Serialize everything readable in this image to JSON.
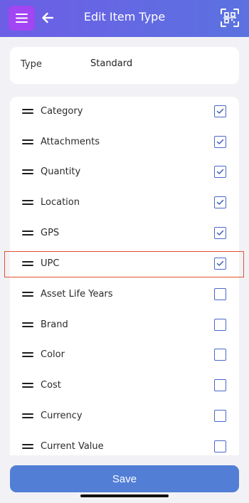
{
  "header": {
    "title": "Edit Item Type",
    "menu_icon": "hamburger-menu-icon",
    "back_icon": "arrow-left-icon",
    "scan_icon": "qr-scan-icon",
    "accent": "#6d5ee6",
    "menu_color": "#a245f2"
  },
  "type": {
    "label": "Type",
    "value": "Standard"
  },
  "fields": [
    {
      "label": "Category",
      "checked": true
    },
    {
      "label": "Attachments",
      "checked": true
    },
    {
      "label": "Quantity",
      "checked": true
    },
    {
      "label": "Location",
      "checked": true
    },
    {
      "label": "GPS",
      "checked": true
    },
    {
      "label": "UPC",
      "checked": true
    },
    {
      "label": "Asset Life Years",
      "checked": false
    },
    {
      "label": "Brand",
      "checked": false
    },
    {
      "label": "Color",
      "checked": false
    },
    {
      "label": "Cost",
      "checked": false
    },
    {
      "label": "Currency",
      "checked": false
    },
    {
      "label": "Current Value",
      "checked": false
    }
  ],
  "highlighted_field": "UPC",
  "save_label": "Save",
  "colors": {
    "button": "#527ed6",
    "checkbox": "#4a67c8",
    "highlight": "#e0522f"
  }
}
